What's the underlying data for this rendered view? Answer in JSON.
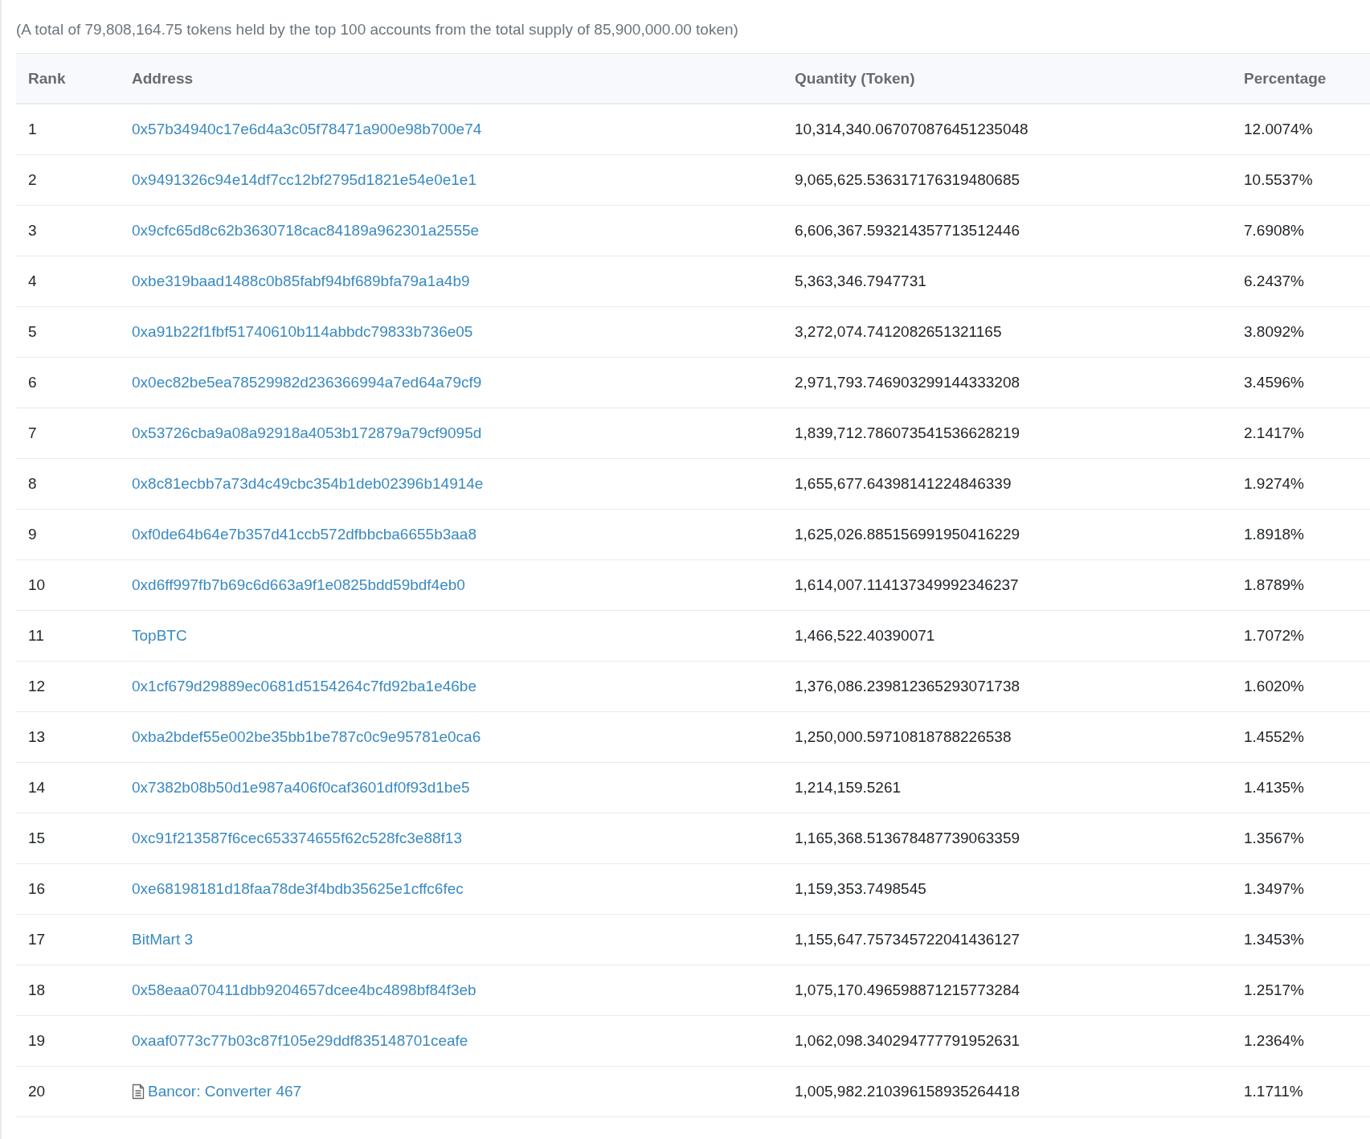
{
  "summary": "(A total of 79,808,164.75 tokens held by the top 100 accounts from the total supply of 85,900,000.00 token)",
  "table": {
    "columns": [
      "Rank",
      "Address",
      "Quantity (Token)",
      "Percentage"
    ],
    "rows": [
      {
        "rank": "1",
        "address": "0x57b34940c17e6d4a3c05f78471a900e98b700e74",
        "kind": "account",
        "quantity": "10,314,340.067070876451235048",
        "percentage": "12.0074%"
      },
      {
        "rank": "2",
        "address": "0x9491326c94e14df7cc12bf2795d1821e54e0e1e1",
        "kind": "account",
        "quantity": "9,065,625.536317176319480685",
        "percentage": "10.5537%"
      },
      {
        "rank": "3",
        "address": "0x9cfc65d8c62b3630718cac84189a962301a2555e",
        "kind": "account",
        "quantity": "6,606,367.593214357713512446",
        "percentage": "7.6908%"
      },
      {
        "rank": "4",
        "address": "0xbe319baad1488c0b85fabf94bf689bfa79a1a4b9",
        "kind": "account",
        "quantity": "5,363,346.7947731",
        "percentage": "6.2437%"
      },
      {
        "rank": "5",
        "address": "0xa91b22f1fbf51740610b114abbdc79833b736e05",
        "kind": "account",
        "quantity": "3,272,074.7412082651321165",
        "percentage": "3.8092%"
      },
      {
        "rank": "6",
        "address": "0x0ec82be5ea78529982d236366994a7ed64a79cf9",
        "kind": "account",
        "quantity": "2,971,793.746903299144333208",
        "percentage": "3.4596%"
      },
      {
        "rank": "7",
        "address": "0x53726cba9a08a92918a4053b172879a79cf9095d",
        "kind": "account",
        "quantity": "1,839,712.786073541536628219",
        "percentage": "2.1417%"
      },
      {
        "rank": "8",
        "address": "0x8c81ecbb7a73d4c49cbc354b1deb02396b14914e",
        "kind": "account",
        "quantity": "1,655,677.64398141224846339",
        "percentage": "1.9274%"
      },
      {
        "rank": "9",
        "address": "0xf0de64b64e7b357d41ccb572dfbbcba6655b3aa8",
        "kind": "account",
        "quantity": "1,625,026.885156991950416229",
        "percentage": "1.8918%"
      },
      {
        "rank": "10",
        "address": "0xd6ff997fb7b69c6d663a9f1e0825bdd59bdf4eb0",
        "kind": "account",
        "quantity": "1,614,007.11413734999234623​7",
        "percentage": "1.8789%"
      },
      {
        "rank": "11",
        "address": "TopBTC",
        "kind": "account",
        "quantity": "1,466,522.40390071",
        "percentage": "1.7072%"
      },
      {
        "rank": "12",
        "address": "0x1cf679d29889ec0681d5154264c7fd92ba1e46be",
        "kind": "account",
        "quantity": "1,376,086.239812365293071738",
        "percentage": "1.6020%"
      },
      {
        "rank": "13",
        "address": "0xba2bdef55e002be35bb1be787c0c9e95781e0ca6",
        "kind": "account",
        "quantity": "1,250,000.59710818788226538",
        "percentage": "1.4552%"
      },
      {
        "rank": "14",
        "address": "0x7382b08b50d1e987a406f0caf3601df0f93d1be5",
        "kind": "account",
        "quantity": "1,214,159.5261",
        "percentage": "1.4135%"
      },
      {
        "rank": "15",
        "address": "0xc91f213587f6cec653374655f62c528fc3e88f13",
        "kind": "account",
        "quantity": "1,165,368.513678487739063359",
        "percentage": "1.3567%"
      },
      {
        "rank": "16",
        "address": "0xe68198181d18faa78de3f4bdb35625e1cffc6fec",
        "kind": "account",
        "quantity": "1,159,353.7498545",
        "percentage": "1.3497%"
      },
      {
        "rank": "17",
        "address": "BitMart 3",
        "kind": "account",
        "quantity": "1,155,647.757345722041436127",
        "percentage": "1.3453%"
      },
      {
        "rank": "18",
        "address": "0x58eaa070411dbb9204657dcee4bc4898bf84f3eb",
        "kind": "account",
        "quantity": "1,075,170.496598871215773284",
        "percentage": "1.2517%"
      },
      {
        "rank": "19",
        "address": "0xaaf0773c77b03c87f105e29ddf835148701ceafe",
        "kind": "account",
        "quantity": "1,062,098.340294777791952631",
        "percentage": "1.2364%"
      },
      {
        "rank": "20",
        "address": "Bancor: Converter 467",
        "kind": "contract",
        "quantity": "1,005,982.210396158935264418",
        "percentage": "1.1711%"
      }
    ]
  }
}
